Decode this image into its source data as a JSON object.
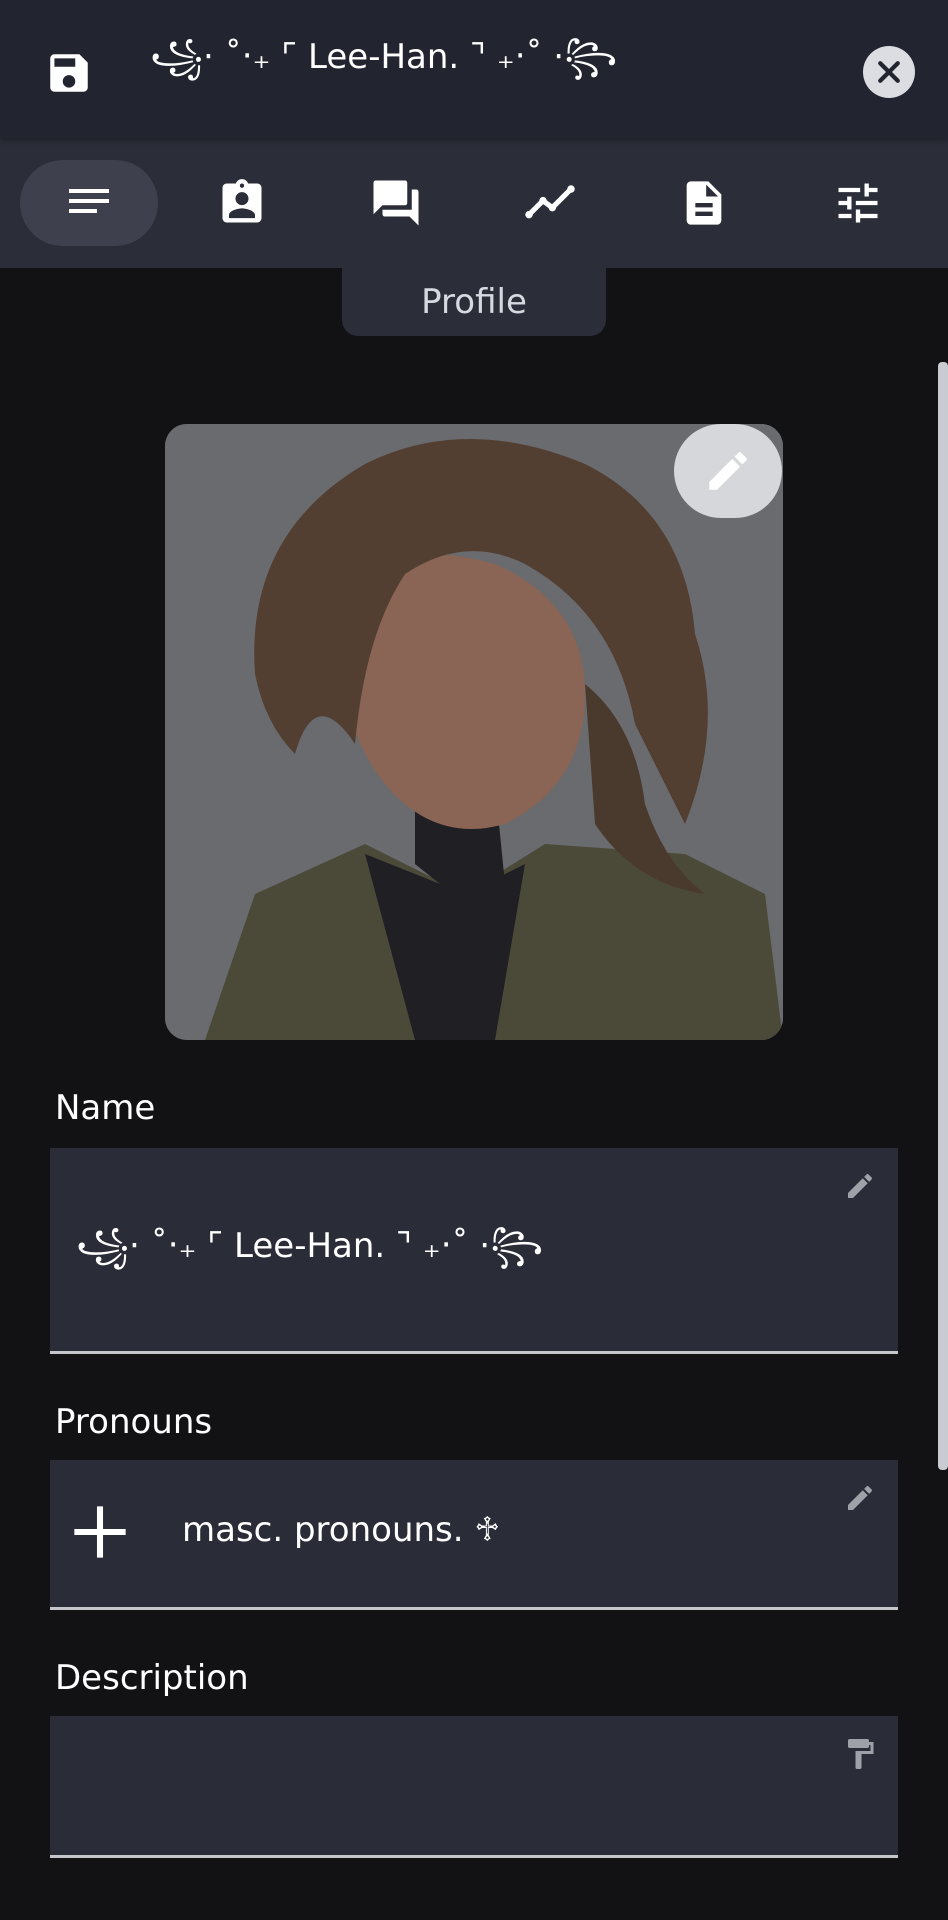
{
  "header": {
    "title": "꧁⋅ ˚‧₊  ⌜ Lee-Han. ⌝ ₊‧˚  ⋅꧂",
    "save_icon": "save-icon",
    "close_icon": "close-icon"
  },
  "tabs": [
    {
      "id": "profile",
      "icon": "lines-icon",
      "active": true
    },
    {
      "id": "identity",
      "icon": "badge-icon",
      "active": false
    },
    {
      "id": "chat",
      "icon": "chat-icon",
      "active": false
    },
    {
      "id": "stats",
      "icon": "trend-icon",
      "active": false
    },
    {
      "id": "document",
      "icon": "document-icon",
      "active": false
    },
    {
      "id": "settings",
      "icon": "sliders-icon",
      "active": false
    }
  ],
  "tab_tooltip": "Profile",
  "avatar": {
    "edit_icon": "pencil-icon"
  },
  "fields": {
    "name": {
      "label": "Name",
      "value": "꧁⋅ ˚‧₊  ⌜ Lee-Han. ⌝ ₊‧˚  ⋅꧂"
    },
    "pronouns": {
      "label": "Pronouns",
      "value": "masc. pronouns.     ♱"
    },
    "description": {
      "label": "Description",
      "value": ""
    }
  },
  "colors": {
    "topbar": "#22242f",
    "tabbar": "#2b2d38",
    "background": "#121215",
    "field": "#2a2c37",
    "accent_light": "#dcdde3"
  }
}
